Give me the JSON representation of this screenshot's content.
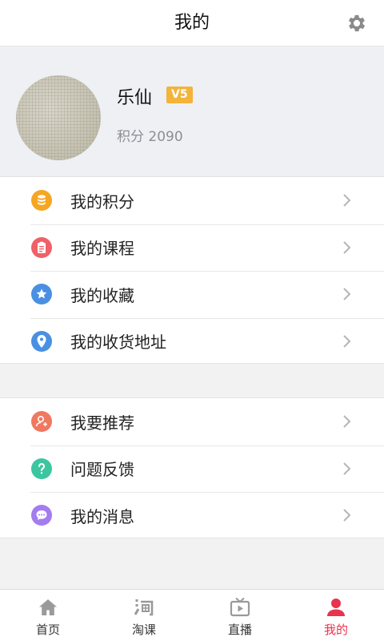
{
  "header": {
    "title": "我的",
    "settings_icon": "gear-icon"
  },
  "profile": {
    "username": "乐仙",
    "level": "V5",
    "points_text": "积分 2090",
    "avatar_icon": "avatar-image"
  },
  "menu_group_1": [
    {
      "label": "我的积分",
      "icon": "coins-icon",
      "color": "#f5a623"
    },
    {
      "label": "我的课程",
      "icon": "clipboard-icon",
      "color": "#f06068"
    },
    {
      "label": "我的收藏",
      "icon": "star-icon",
      "color": "#4a90e2"
    },
    {
      "label": "我的收货地址",
      "icon": "location-pin-icon",
      "color": "#4a90e2"
    }
  ],
  "menu_group_2": [
    {
      "label": "我要推荐",
      "icon": "user-recommend-icon",
      "color": "#f07860"
    },
    {
      "label": "问题反馈",
      "icon": "question-icon",
      "color": "#3cc6a0"
    },
    {
      "label": "我的消息",
      "icon": "message-icon",
      "color": "#a37cf0"
    }
  ],
  "tabbar": {
    "tabs": [
      {
        "label": "首页",
        "icon": "home-icon",
        "active": false
      },
      {
        "label": "淘课",
        "icon": "taoke-icon",
        "active": false
      },
      {
        "label": "直播",
        "icon": "live-tv-icon",
        "active": false
      },
      {
        "label": "我的",
        "icon": "person-icon",
        "active": true
      }
    ],
    "active_color": "#e8344e",
    "inactive_color": "#8a8a8a"
  }
}
